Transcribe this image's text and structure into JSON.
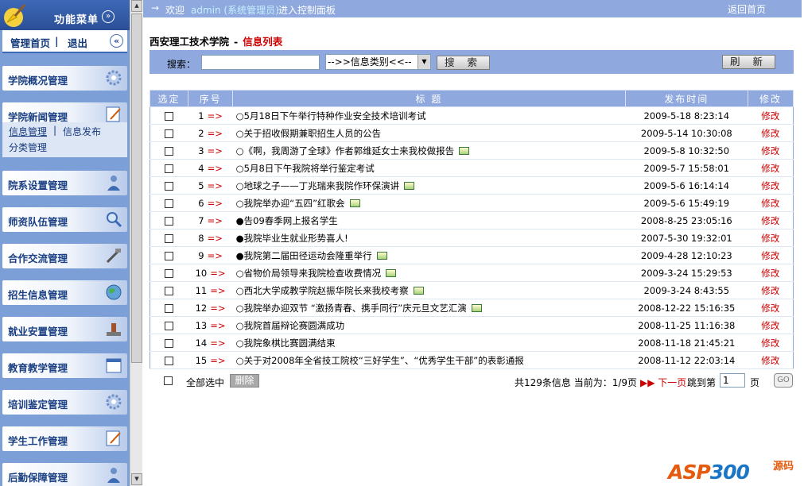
{
  "sidebar": {
    "menu_title": "功能菜单",
    "home_link": "管理首页",
    "separator": "|",
    "logout_link": "退出",
    "sections": [
      {
        "label": "学院概况管理",
        "icon": "gear-icon"
      },
      {
        "label": "学院新闻管理",
        "icon": "edit-icon"
      },
      {
        "label": "院系设置管理",
        "icon": "person-icon"
      },
      {
        "label": "师资队伍管理",
        "icon": "magnifier-icon"
      },
      {
        "label": "合作交流管理",
        "icon": "tools-icon"
      },
      {
        "label": "招生信息管理",
        "icon": "globe-icon"
      },
      {
        "label": "就业安置管理",
        "icon": "stamp-icon"
      },
      {
        "label": "教育教学管理",
        "icon": "calendar-icon"
      },
      {
        "label": "培训鉴定管理",
        "icon": "gear-icon"
      },
      {
        "label": "学生工作管理",
        "icon": "edit-icon"
      },
      {
        "label": "后勤保障管理",
        "icon": "person-icon"
      }
    ],
    "sub_items": {
      "info_manage": "信息管理",
      "sep": "|",
      "info_publish": "信息发布",
      "category_manage": "分类管理"
    }
  },
  "header": {
    "arrow": "→",
    "welcome": "欢迎",
    "admin": "admin (系统管理员)",
    "enter": "进入控制面板",
    "back_home": "返回首页"
  },
  "heading": {
    "school": "西安理工技术学院",
    "dash": "-",
    "list": "信息列表"
  },
  "search": {
    "label": "搜索：",
    "input_value": "",
    "category_select": "-->>信息类别<<--",
    "search_button": "搜 索",
    "refresh_button": "刷 新"
  },
  "table": {
    "headers": {
      "select": "选定",
      "seq": "序号",
      "title": "标 题",
      "date": "发布时间",
      "edit": "修改"
    },
    "arrow": "=>",
    "edit_label": "修改",
    "rows": [
      {
        "seq": "1",
        "title": "○5月18日下午举行特种作业安全技术培训考试",
        "date": "2009-5-18 8:23:14",
        "has_image": false
      },
      {
        "seq": "2",
        "title": "○关于招收假期兼职招生人员的公告",
        "date": "2009-5-14 10:30:08",
        "has_image": false
      },
      {
        "seq": "3",
        "title": "○《啊，我周游了全球》作者郭维延女士来我校做报告",
        "date": "2009-5-8 10:32:50",
        "has_image": true
      },
      {
        "seq": "4",
        "title": "○5月8日下午我院将举行鉴定考试",
        "date": "2009-5-7 15:58:01",
        "has_image": false
      },
      {
        "seq": "5",
        "title": "○地球之子——丁兆瑞来我院作环保演讲",
        "date": "2009-5-6 16:14:14",
        "has_image": true
      },
      {
        "seq": "6",
        "title": "○我院举办迎“五四”红歌会",
        "date": "2009-5-6 15:49:19",
        "has_image": true
      },
      {
        "seq": "7",
        "title": "●告09春季网上报名学生",
        "date": "2008-8-25 23:05:16",
        "has_image": false
      },
      {
        "seq": "8",
        "title": "●我院毕业生就业形势喜人!",
        "date": "2007-5-30 19:32:01",
        "has_image": false
      },
      {
        "seq": "9",
        "title": "●我院第二届田径运动会隆重举行",
        "date": "2009-4-28 12:10:23",
        "has_image": true
      },
      {
        "seq": "10",
        "title": "○省物价局领导来我院检查收费情况",
        "date": "2009-3-24 15:29:53",
        "has_image": true
      },
      {
        "seq": "11",
        "title": "○西北大学成教学院赵振华院长来我校考察",
        "date": "2009-3-24 8:43:55",
        "has_image": true
      },
      {
        "seq": "12",
        "title": "○我院举办迎双节 “激扬青春、携手同行”庆元旦文艺汇演",
        "date": "2008-12-22 15:16:35",
        "has_image": true
      },
      {
        "seq": "13",
        "title": "○我院首届辩论赛圆满成功",
        "date": "2008-11-25 11:16:38",
        "has_image": false
      },
      {
        "seq": "14",
        "title": "○我院象棋比赛圆满结束",
        "date": "2008-11-18 21:45:21",
        "has_image": false
      },
      {
        "seq": "15",
        "title": "○关于对2008年全省技工院校“三好学生”、“优秀学生干部”的表彰通报",
        "date": "2008-11-12 22:03:14",
        "has_image": false
      }
    ]
  },
  "footer": {
    "select_all": "全部选中",
    "delete_button": "删除",
    "stats": "共129条信息  当前为：1/9页",
    "next_page": "下一页",
    "jump_to": "跳到第",
    "page_value": "1",
    "page_unit": "页",
    "go_button": "GO"
  },
  "watermark": {
    "asp": "ASP",
    "num": "300",
    "source": "源码"
  }
}
